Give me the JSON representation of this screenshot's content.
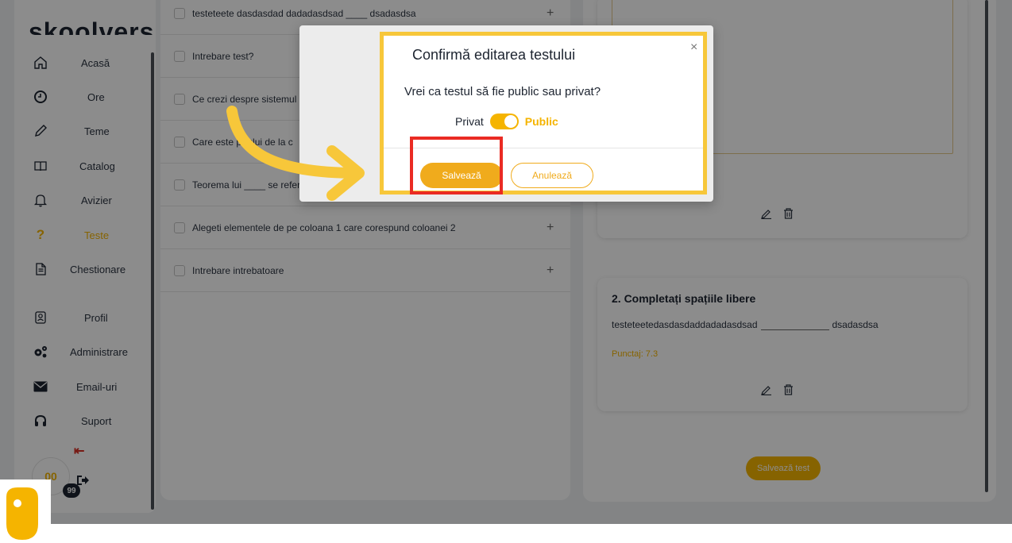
{
  "app": {
    "logo_text": "skoolvers"
  },
  "sidebar": {
    "items": [
      {
        "label": "Acasă",
        "icon": "home-icon"
      },
      {
        "label": "Ore",
        "icon": "clock-icon"
      },
      {
        "label": "Teme",
        "icon": "pencil-icon"
      },
      {
        "label": "Catalog",
        "icon": "book-icon"
      },
      {
        "label": "Avizier",
        "icon": "bell-icon"
      },
      {
        "label": "Teste",
        "icon": "question-icon",
        "active": true
      },
      {
        "label": "Chestionare",
        "icon": "document-icon"
      },
      {
        "label": "Profil",
        "icon": "profile-icon"
      },
      {
        "label": "Administrare",
        "icon": "gears-icon"
      },
      {
        "label": "Email-uri",
        "icon": "mail-icon"
      },
      {
        "label": "Suport",
        "icon": "headset-icon"
      }
    ],
    "badge_initials": "00",
    "badge_count": "99"
  },
  "questions": {
    "items": [
      "testeteete dasdasdad dadadasdsad ____ dsadasdsa",
      "Intrebare test?",
      "Ce crezi despre sistemul",
      "Care este pr    ului de la c",
      "Teorema lui ____ se refer",
      "Alegeti elementele de pe coloana 1 care corespund coloanei 2",
      "Intrebare intrebatoare"
    ]
  },
  "right_panel": {
    "card2_title": "2. Completați spațiile libere",
    "card2_text_before": "testeteetedasdasdaddadadasdsad",
    "card2_text_after": "dsadasdsa",
    "card2_score": "Punctaj: 7.3",
    "save_test_label": "Salvează test"
  },
  "modal": {
    "title": "Confirmă editarea testului",
    "close_symbol": "×",
    "question": "Vrei ca testul să fie public sau privat?",
    "private_label": "Privat",
    "public_label": "Public",
    "toggle_state": "public",
    "save_label": "Salvează",
    "cancel_label": "Anulează"
  },
  "colors": {
    "accent": "#f5b400",
    "highlight_border": "#f7c73a",
    "annotation_red": "#ea2b23",
    "arrow": "#f7c73a"
  }
}
